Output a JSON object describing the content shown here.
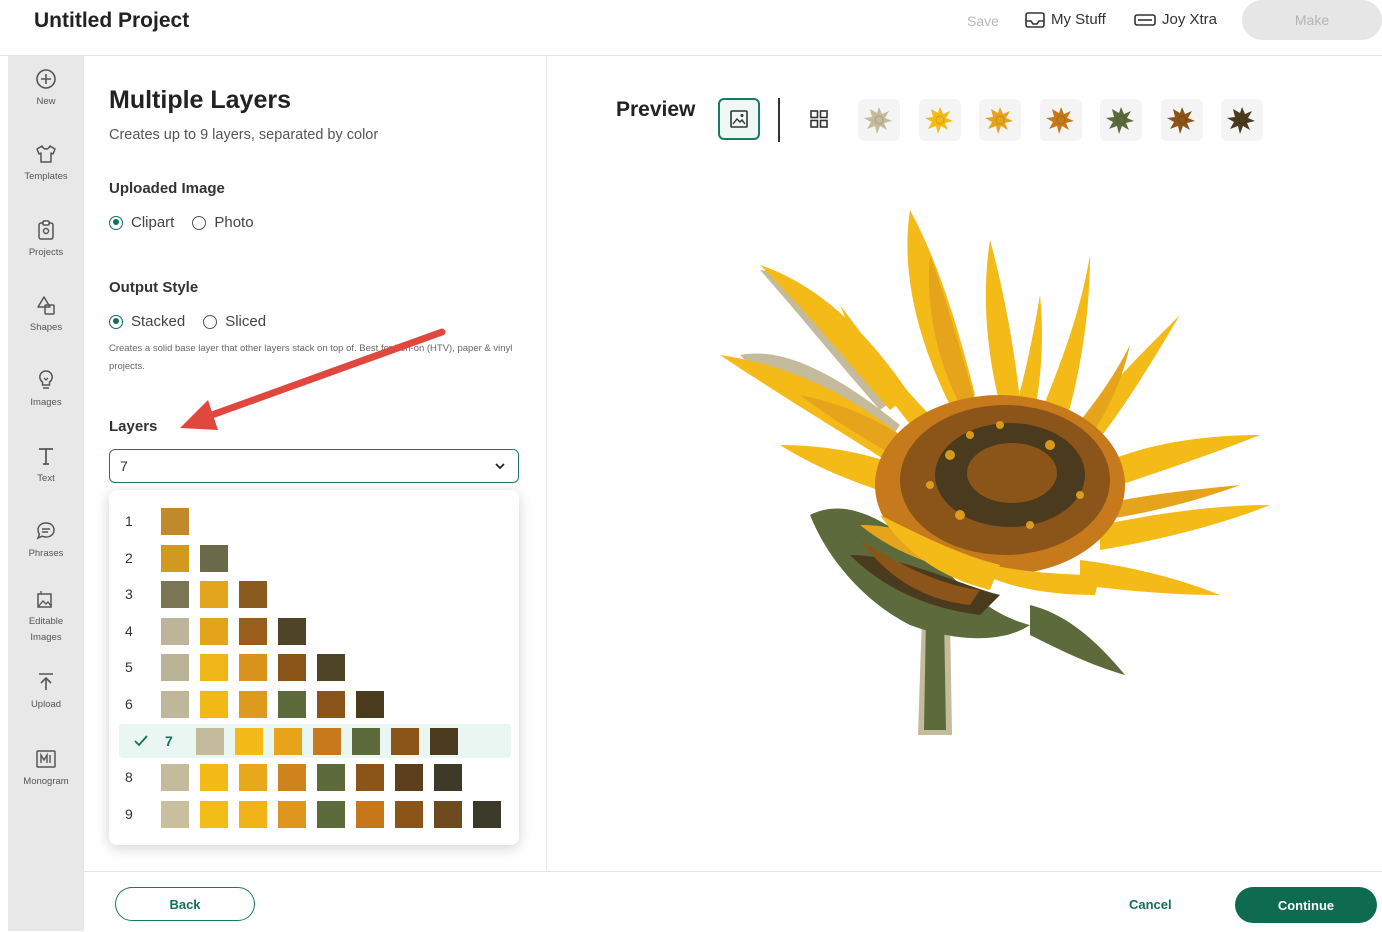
{
  "header": {
    "title": "Untitled Project",
    "save_label": "Save",
    "my_stuff_label": "My Stuff",
    "joy_xtra_label": "Joy Xtra",
    "make_label": "Make"
  },
  "sidebar": {
    "items": [
      {
        "label": "New",
        "icon": "plus-circle-icon"
      },
      {
        "label": "Templates",
        "icon": "shirt-icon"
      },
      {
        "label": "Projects",
        "icon": "clipboard-icon"
      },
      {
        "label": "Shapes",
        "icon": "shapes-icon"
      },
      {
        "label": "Images",
        "icon": "lightbulb-icon"
      },
      {
        "label": "Text",
        "icon": "text-icon"
      },
      {
        "label": "Phrases",
        "icon": "chat-icon"
      },
      {
        "label": "Editable Images",
        "icon": "editable-image-icon"
      },
      {
        "label": "Upload",
        "icon": "upload-icon"
      },
      {
        "label": "Monogram",
        "icon": "monogram-icon"
      }
    ]
  },
  "panel": {
    "title": "Multiple Layers",
    "subtitle": "Creates up to 9 layers, separated by color",
    "uploaded_image_label": "Uploaded Image",
    "image_types": [
      "Clipart",
      "Photo"
    ],
    "image_type_selected": "Clipart",
    "output_style_label": "Output Style",
    "output_styles": [
      "Stacked",
      "Sliced"
    ],
    "output_style_selected": "Stacked",
    "output_style_desc": "Creates a solid base layer that other layers stack on top of. Best for iron-on (HTV), paper & vinyl projects.",
    "layers_label": "Layers",
    "layers_value": "7"
  },
  "layer_options": [
    {
      "n": "1",
      "colors": [
        "#c08a2a"
      ]
    },
    {
      "n": "2",
      "colors": [
        "#d19a1f",
        "#6a6a4a"
      ]
    },
    {
      "n": "3",
      "colors": [
        "#7a7654",
        "#e4a51e",
        "#8a5a1e"
      ]
    },
    {
      "n": "4",
      "colors": [
        "#bdb49a",
        "#e3a31b",
        "#9a5e1c",
        "#4e4426"
      ]
    },
    {
      "n": "5",
      "colors": [
        "#bbb396",
        "#f0b617",
        "#d8931c",
        "#8b5519",
        "#4e4426"
      ]
    },
    {
      "n": "6",
      "colors": [
        "#bfb79a",
        "#f2b818",
        "#dc9a1e",
        "#5d6a3b",
        "#8b5519",
        "#4a3a1e"
      ]
    },
    {
      "n": "7",
      "colors": [
        "#c4bb9c",
        "#f4ba18",
        "#e6a41c",
        "#c77a1b",
        "#5d6a3b",
        "#8b5519",
        "#4a3a1e"
      ],
      "selected": true
    },
    {
      "n": "8",
      "colors": [
        "#c4bb9c",
        "#f4ba18",
        "#e8a81c",
        "#cf841b",
        "#5d6a3b",
        "#8b5519",
        "#5e3f1c",
        "#3f3a28"
      ]
    },
    {
      "n": "9",
      "colors": [
        "#c9bf9d",
        "#f3bc17",
        "#f0b419",
        "#de961e",
        "#5d6a3b",
        "#c67719",
        "#8b5519",
        "#6d4a1f",
        "#3b3a28"
      ]
    }
  ],
  "preview": {
    "title": "Preview",
    "thumbnail_colors": [
      "#c4bb9c",
      "#f4ba18",
      "#e6a41c",
      "#c77a1b",
      "#5d6a3b",
      "#8b5519",
      "#4a3a1e"
    ]
  },
  "footer": {
    "back_label": "Back",
    "cancel_label": "Cancel",
    "continue_label": "Continue"
  },
  "colors": {
    "accent": "#11705a",
    "continue_bg": "#0f6b4f",
    "arrow": "#e0483f"
  }
}
